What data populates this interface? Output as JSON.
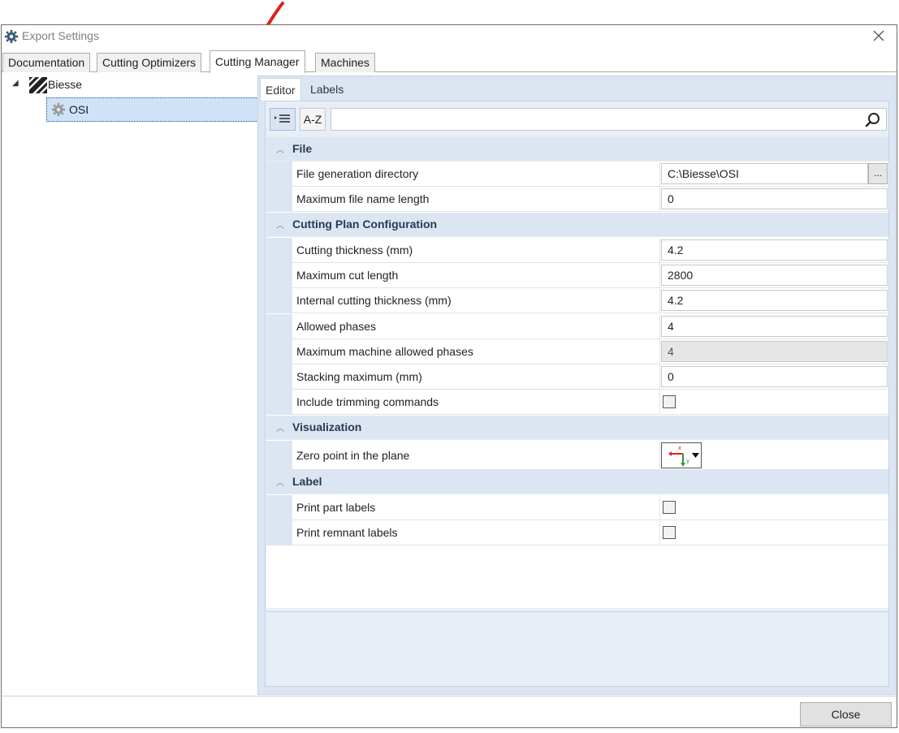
{
  "window": {
    "title": "Export Settings"
  },
  "tabs": [
    {
      "label": "Documentation",
      "active": false
    },
    {
      "label": "Cutting Optimizers",
      "active": false
    },
    {
      "label": "Cutting Manager",
      "active": true
    },
    {
      "label": "Machines",
      "active": false
    }
  ],
  "tree": {
    "root": {
      "label": "Biesse",
      "expanded": true
    },
    "child": {
      "label": "OSI",
      "selected": true
    }
  },
  "subtabs": [
    {
      "label": "Editor",
      "active": true
    },
    {
      "label": "Labels",
      "active": false
    }
  ],
  "toolbar": {
    "categorized_icon": "categorized-list-icon",
    "alpha_label": "A-Z",
    "search_placeholder": ""
  },
  "categories": [
    {
      "label": "File",
      "properties": [
        {
          "name": "File generation directory",
          "value": "C:\\Biesse\\OSI",
          "type": "path",
          "browse_label": "..."
        },
        {
          "name": "Maximum file name length",
          "value": "0",
          "type": "text"
        }
      ]
    },
    {
      "label": "Cutting Plan Configuration",
      "properties": [
        {
          "name": "Cutting thickness (mm)",
          "value": "4.2",
          "type": "text"
        },
        {
          "name": "Maximum cut length",
          "value": "2800",
          "type": "text"
        },
        {
          "name": "Internal cutting thickness (mm)",
          "value": "4.2",
          "type": "text"
        },
        {
          "name": "Allowed phases",
          "value": "4",
          "type": "text"
        },
        {
          "name": "Maximum machine allowed phases",
          "value": "4",
          "type": "readonly"
        },
        {
          "name": "Stacking maximum (mm)",
          "value": "0",
          "type": "text"
        },
        {
          "name": "Include trimming commands",
          "value": false,
          "type": "checkbox"
        }
      ]
    },
    {
      "label": "Visualization",
      "properties": [
        {
          "name": "Zero point in the plane",
          "value": "zero-point-picker",
          "type": "picker"
        }
      ]
    },
    {
      "label": "Label",
      "properties": [
        {
          "name": "Print part labels",
          "value": false,
          "type": "checkbox"
        },
        {
          "name": "Print remnant labels",
          "value": false,
          "type": "checkbox"
        }
      ]
    }
  ],
  "footer": {
    "close_label": "Close"
  },
  "colors": {
    "accent": "#cfe3f8",
    "grid_band": "#dce6f3",
    "annotation": "#e0201c"
  }
}
